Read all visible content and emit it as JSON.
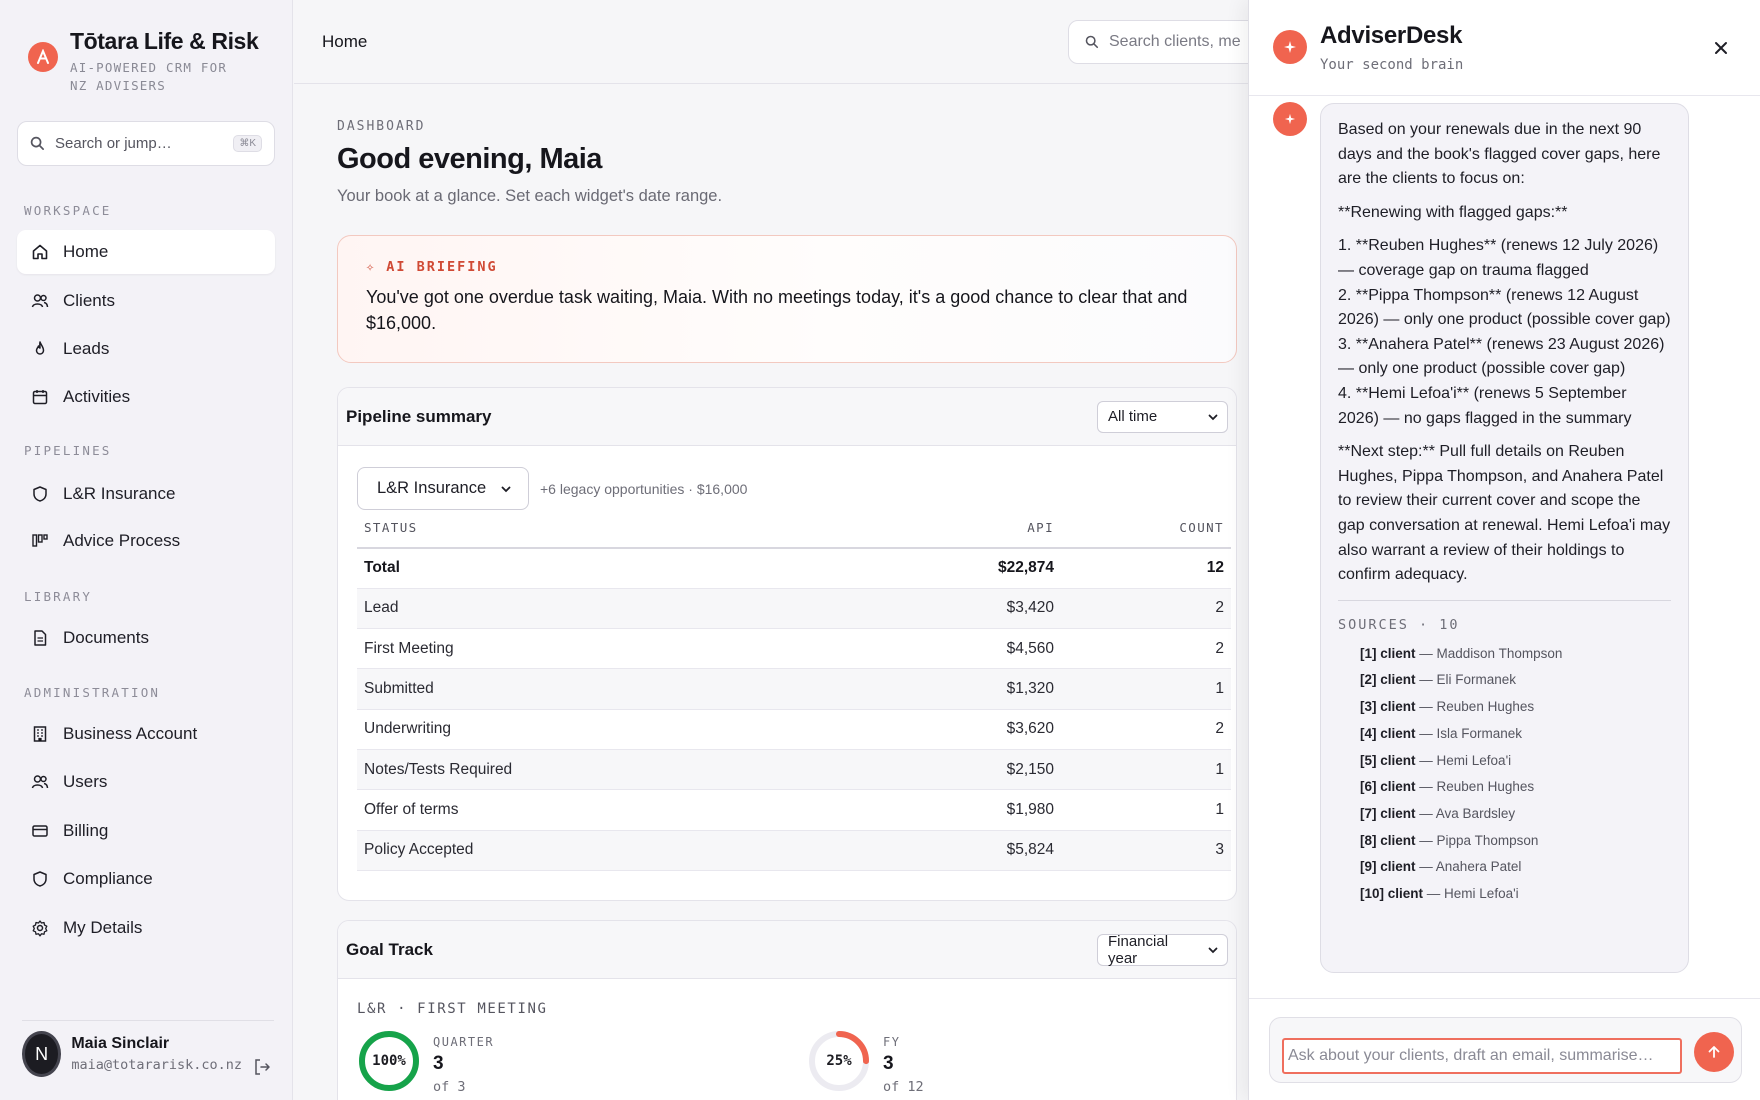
{
  "brand": {
    "name": "Tōtara Life & Risk",
    "tagline": "AI-POWERED CRM FOR NZ ADVISERS",
    "logo_letter": "A"
  },
  "sidebar": {
    "search_placeholder": "Search or jump…",
    "search_shortcut": "⌘K",
    "sections": {
      "workspace": "WORKSPACE",
      "pipelines": "PIPELINES",
      "library": "LIBRARY",
      "administration": "ADMINISTRATION"
    },
    "items": {
      "home": {
        "label": "Home",
        "icon": "home-icon"
      },
      "clients": {
        "label": "Clients",
        "icon": "users-icon"
      },
      "leads": {
        "label": "Leads",
        "icon": "flame-icon"
      },
      "activities": {
        "label": "Activities",
        "icon": "calendar-icon"
      },
      "lr_insurance": {
        "label": "L&R Insurance",
        "icon": "shield-icon"
      },
      "advice_process": {
        "label": "Advice Process",
        "icon": "kanban-icon"
      },
      "documents": {
        "label": "Documents",
        "icon": "document-icon"
      },
      "business_account": {
        "label": "Business Account",
        "icon": "building-icon"
      },
      "users": {
        "label": "Users",
        "icon": "users-icon"
      },
      "billing": {
        "label": "Billing",
        "icon": "credit-card-icon"
      },
      "compliance": {
        "label": "Compliance",
        "icon": "shield-icon"
      },
      "my_details": {
        "label": "My Details",
        "icon": "gear-icon"
      }
    },
    "active": "home"
  },
  "user": {
    "initial": "N",
    "name": "Maia Sinclair",
    "email": "maia@totararisk.co.nz"
  },
  "header": {
    "breadcrumb": "Home",
    "search_placeholder": "Search clients, me"
  },
  "dashboard": {
    "eyebrow": "DASHBOARD",
    "greeting": "Good evening, Maia",
    "subtitle": "Your book at a glance. Set each widget's date range.",
    "briefing": {
      "tag": "✧ AI BRIEFING",
      "line1": "You've got one overdue task waiting, Maia. With no meetings today, it's a good chance to clear that and",
      "line2": "$16,000."
    }
  },
  "pipeline": {
    "title": "Pipeline summary",
    "range": "All time",
    "pipeline_select": "L&R Insurance",
    "legacy_note": "+6 legacy opportunities · $16,000",
    "columns": [
      "STATUS",
      "API",
      "COUNT"
    ],
    "total": {
      "status": "Total",
      "api": "$22,874",
      "count": "12"
    },
    "rows": [
      {
        "status": "Lead",
        "api": "$3,420",
        "count": "2"
      },
      {
        "status": "First Meeting",
        "api": "$4,560",
        "count": "2"
      },
      {
        "status": "Submitted",
        "api": "$1,320",
        "count": "1"
      },
      {
        "status": "Underwriting",
        "api": "$3,620",
        "count": "2"
      },
      {
        "status": "Notes/Tests Required",
        "api": "$2,150",
        "count": "1"
      },
      {
        "status": "Offer of terms",
        "api": "$1,980",
        "count": "1"
      },
      {
        "status": "Policy Accepted",
        "api": "$5,824",
        "count": "3"
      }
    ]
  },
  "goal_track": {
    "title": "Goal Track",
    "range": "Financial year",
    "metric_label": "L&R · FIRST MEETING",
    "quarter": {
      "label": "QUARTER",
      "percent_text": "100%",
      "fraction": 1.0,
      "value": "3",
      "of": "of 3",
      "color": "#16a34a"
    },
    "fy": {
      "label": "FY",
      "percent_text": "25%",
      "fraction": 0.25,
      "value": "3",
      "of": "of 12",
      "color": "#f0644f"
    }
  },
  "panel": {
    "title": "AdviserDesk",
    "subtitle": "Your second brain",
    "message": {
      "intro": "Based on your renewals due in the next 90 days and the book's flagged cover gaps, here are the clients to focus on:",
      "heading": "**Renewing with flagged gaps:**",
      "items": [
        "1. **Reuben Hughes** (renews 12 July 2026) — coverage gap on trauma flagged",
        "2. **Pippa Thompson** (renews 12 August 2026) — only one product (possible cover gap)",
        "3. **Anahera Patel** (renews 23 August 2026) — only one product (possible cover gap)",
        "4. **Hemi Lefoa'i** (renews 5 September 2026) — no gaps flagged in the summary"
      ],
      "next_step": "**Next step:** Pull full details on Reuben Hughes, Pippa Thompson, and Anahera Patel to review their current cover and scope the gap conversation at renewal. Hemi Lefoa'i may also warrant a review of their holdings to confirm adequacy."
    },
    "sources_header": "SOURCES · 10",
    "sources": [
      {
        "ref": "[1] client",
        "name": "— Maddison Thompson"
      },
      {
        "ref": "[2] client",
        "name": "— Eli Formanek"
      },
      {
        "ref": "[3] client",
        "name": "— Reuben Hughes"
      },
      {
        "ref": "[4] client",
        "name": "— Isla Formanek"
      },
      {
        "ref": "[5] client",
        "name": "— Hemi Lefoa'i"
      },
      {
        "ref": "[6] client",
        "name": "— Reuben Hughes"
      },
      {
        "ref": "[7] client",
        "name": "— Ava Bardsley"
      },
      {
        "ref": "[8] client",
        "name": "— Pippa Thompson"
      },
      {
        "ref": "[9] client",
        "name": "— Anahera Patel"
      },
      {
        "ref": "[10] client",
        "name": "— Hemi Lefoa'i"
      }
    ],
    "input_placeholder": "Ask about your clients, draft an email, summarise…"
  },
  "colors": {
    "accent": "#f0644f",
    "success": "#16a34a",
    "sidebar_bg": "#f3f2f7"
  }
}
